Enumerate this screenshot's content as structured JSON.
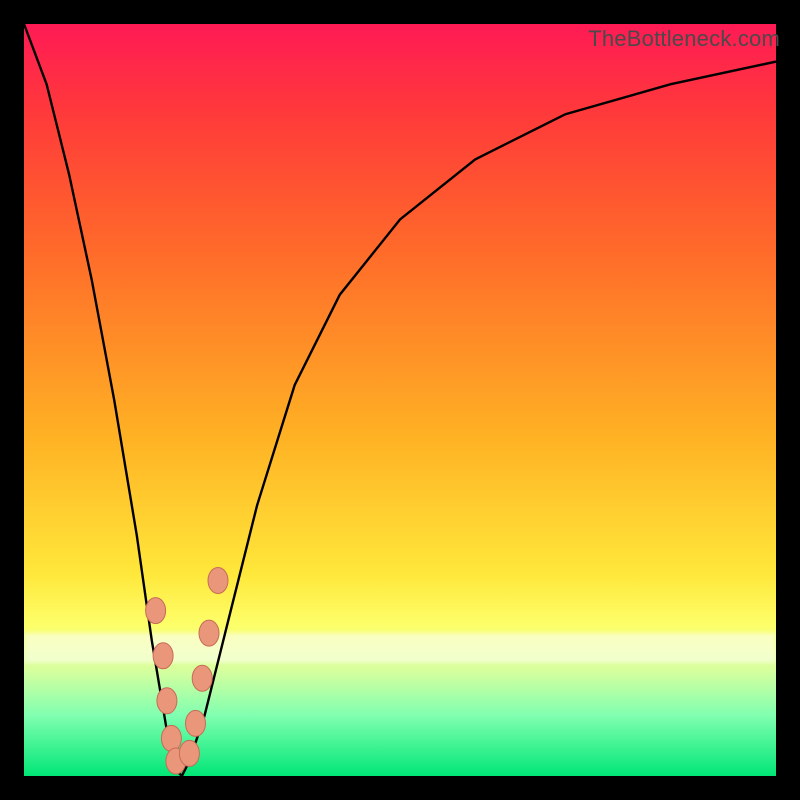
{
  "watermark": "TheBottleneck.com",
  "colors": {
    "background": "#000000",
    "curve": "#000000",
    "dots_fill": "#e9967a",
    "dots_stroke": "#c86b57"
  },
  "chart_data": {
    "type": "line",
    "title": "",
    "xlabel": "",
    "ylabel": "",
    "xlim": [
      0,
      100
    ],
    "ylim": [
      0,
      100
    ],
    "series": [
      {
        "name": "bottleneck-curve",
        "x": [
          0,
          3,
          6,
          9,
          12,
          15,
          17,
          19,
          20,
          21,
          22,
          24,
          27,
          31,
          36,
          42,
          50,
          60,
          72,
          86,
          100
        ],
        "values": [
          100,
          92,
          80,
          66,
          50,
          32,
          18,
          6,
          1,
          0,
          2,
          8,
          20,
          36,
          52,
          64,
          74,
          82,
          88,
          92,
          95
        ]
      }
    ],
    "scatter": [
      {
        "name": "dots-left",
        "x": [
          17.5,
          18.5,
          19.0,
          19.6,
          20.2
        ],
        "values": [
          22,
          16,
          10,
          5,
          2
        ]
      },
      {
        "name": "dots-right",
        "x": [
          22.0,
          22.8,
          23.7,
          24.6,
          25.8
        ],
        "values": [
          3,
          7,
          13,
          19,
          26
        ]
      }
    ],
    "minimum_x": 21
  }
}
